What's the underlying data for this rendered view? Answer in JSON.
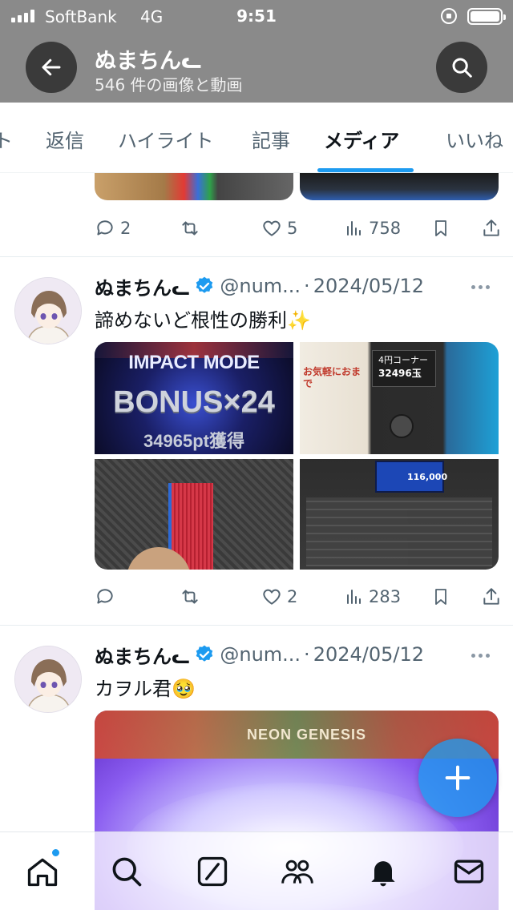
{
  "status_bar": {
    "carrier": "SoftBank",
    "network": "4G",
    "time": "9:51"
  },
  "header": {
    "profile_name": "ぬまちんᓚ",
    "subtitle": "546 件の画像と動画",
    "back_icon": "arrow-left-icon",
    "search_icon": "search-icon"
  },
  "tabs": {
    "items": [
      "ト",
      "返信",
      "ハイライト",
      "記事",
      "メディア",
      "いいね"
    ],
    "active": "メディア"
  },
  "posts": [
    {
      "actions": {
        "replies": "2",
        "reposts": "",
        "likes": "5",
        "views": "758"
      }
    },
    {
      "name": "ぬまちんᓚ",
      "handle": "@num...",
      "dot": "·",
      "date": "2024/05/12",
      "text": "諦めないど根性の勝利✨",
      "media_text": {
        "impact": "IMPACT MODE",
        "bonus": "BONUS×24",
        "pt": "34965pt獲得",
        "counter_label": "4円コーナー",
        "counter_value": "32496玉",
        "sign": "お気軽におまで",
        "screen_value": "116,000"
      },
      "actions": {
        "replies": "",
        "reposts": "",
        "likes": "2",
        "views": "283"
      }
    },
    {
      "name": "ぬまちんᓚ",
      "handle": "@num...",
      "dot": "·",
      "date": "2024/05/12",
      "text": "カヲル君🥹",
      "media_text": {
        "banner": "NEON GENESIS"
      }
    }
  ],
  "fab": {
    "icon": "plus-icon"
  },
  "bottom_nav": {
    "items": [
      "home-icon",
      "search-icon",
      "grok-icon",
      "communities-icon",
      "notifications-icon",
      "messages-icon"
    ]
  },
  "colors": {
    "accent": "#1d9bf0",
    "header_bg": "#8a8a8a",
    "text_secondary": "#536471",
    "verified": "#1d9bf0"
  }
}
